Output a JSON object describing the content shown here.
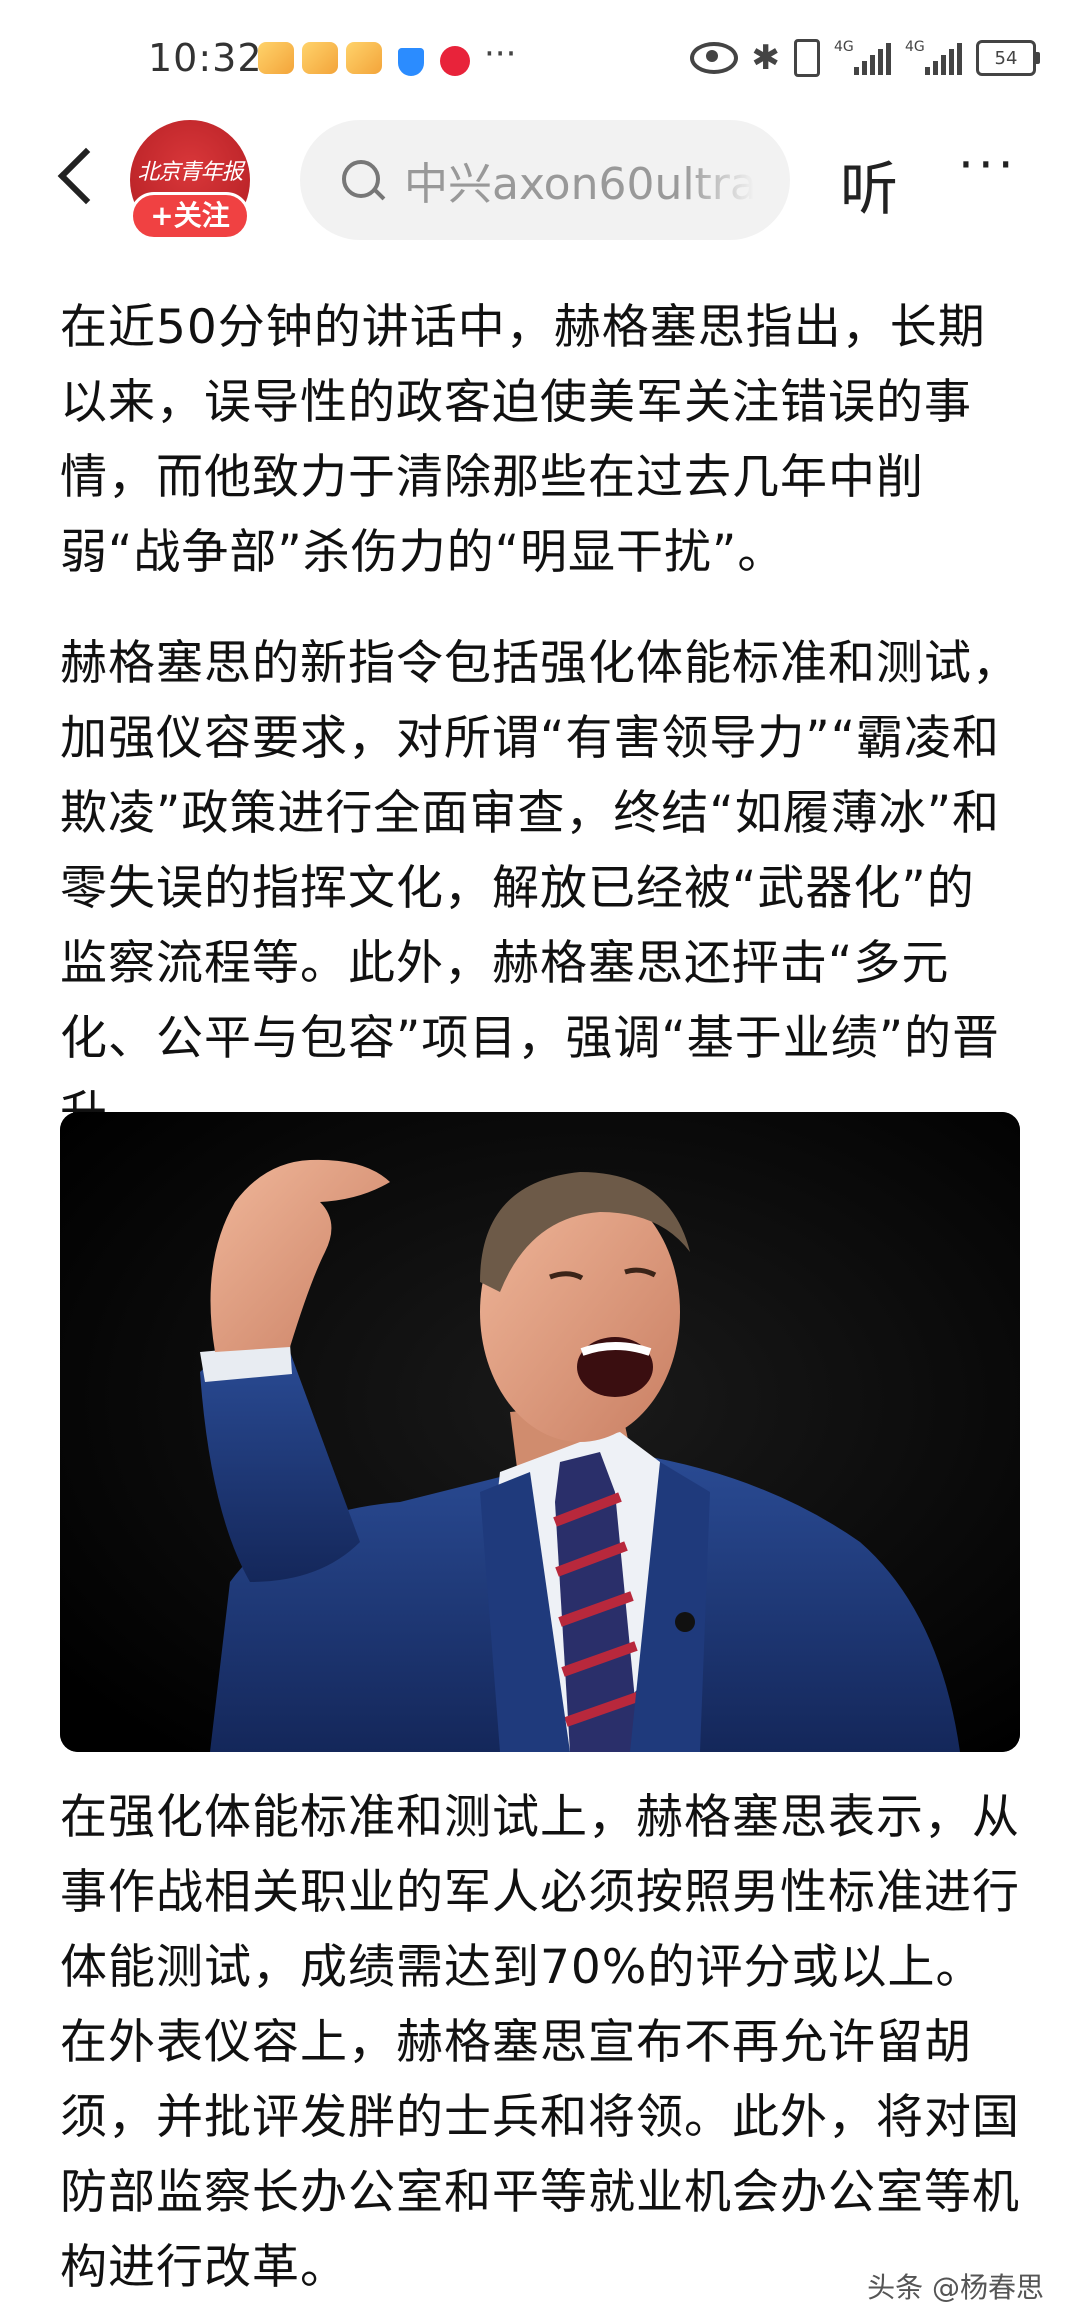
{
  "status_bar": {
    "time": "10:32",
    "more": "···",
    "network_1": "4G",
    "network_2": "4G",
    "battery": "54"
  },
  "header": {
    "avatar_text": "北京青年报",
    "follow_label": "+关注",
    "search_value": "中兴axon60ultra",
    "listen_label": "听",
    "more_label": "···"
  },
  "article": {
    "paragraphs": [
      "在近50分钟的讲话中，赫格塞思指出，长期以来，误导性的政客迫使美军关注错误的事情，而他致力于清除那些在过去几年中削弱“战争部”杀伤力的“明显干扰”。",
      "赫格塞思的新指令包括强化体能标准和测试，加强仪容要求，对所谓“有害领导力”“霸凌和欺凌”政策进行全面审查，终结“如履薄冰”和零失误的指挥文化，解放已经被“武器化”的监察流程等。此外，赫格塞思还抨击“多元化、公平与包容”项目，强调“基于业绩”的晋升。",
      "在强化体能标准和测试上，赫格塞思表示，从事作战相关职业的军人必须按照男性标准进行体能测试，成绩需达到70%的评分或以上。在外表仪容上，赫格塞思宣布不再允许留胡须，并批评发胖的士兵和将领。此外，将对国防部监察长办公室和平等就业机会办公室等机构进行改革。"
    ],
    "watermark": "头条 @杨春思"
  },
  "colors": {
    "follow_bg": "#f04142",
    "search_bg": "#f2f2f2",
    "suit": "#1d3a78"
  }
}
